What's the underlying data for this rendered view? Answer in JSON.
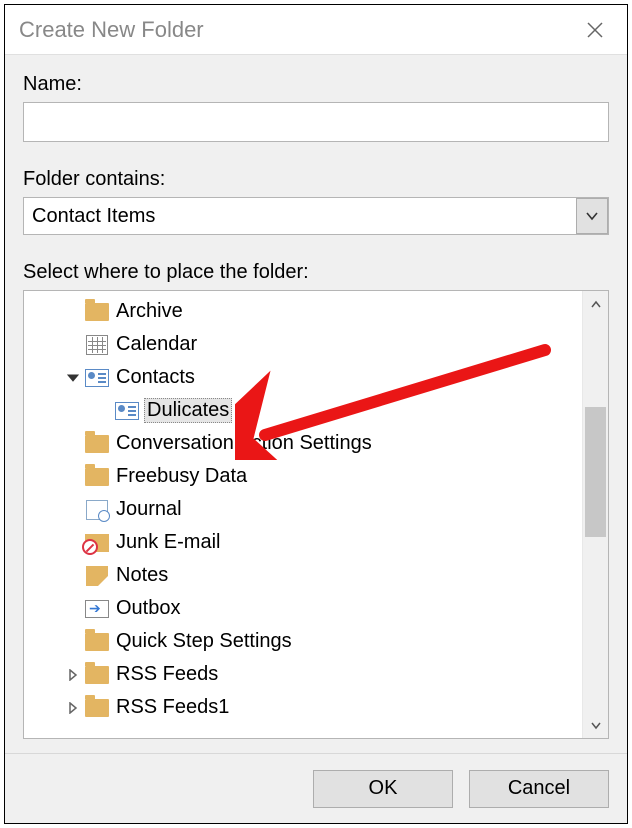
{
  "title": "Create New Folder",
  "labels": {
    "name": "Name:",
    "folder_contains": "Folder contains:",
    "select_where": "Select where to place the folder:"
  },
  "fields": {
    "name_value": "",
    "folder_contains_value": "Contact Items"
  },
  "tree": {
    "items": [
      {
        "label": "Archive",
        "icon": "folder",
        "indent": 2,
        "arrow": ""
      },
      {
        "label": "Calendar",
        "icon": "calendar",
        "indent": 2,
        "arrow": ""
      },
      {
        "label": "Contacts",
        "icon": "contacts",
        "indent": 2,
        "arrow": "down"
      },
      {
        "label": "Dulicates",
        "icon": "contacts",
        "indent": 3,
        "arrow": "",
        "selected": true
      },
      {
        "label": "Conversation Action Settings",
        "icon": "folder",
        "indent": 2,
        "arrow": ""
      },
      {
        "label": "Freebusy Data",
        "icon": "folder",
        "indent": 2,
        "arrow": ""
      },
      {
        "label": "Journal",
        "icon": "journal",
        "indent": 2,
        "arrow": ""
      },
      {
        "label": "Junk E-mail",
        "icon": "junk",
        "indent": 2,
        "arrow": ""
      },
      {
        "label": "Notes",
        "icon": "notes",
        "indent": 2,
        "arrow": ""
      },
      {
        "label": "Outbox",
        "icon": "outbox",
        "indent": 2,
        "arrow": ""
      },
      {
        "label": "Quick Step Settings",
        "icon": "folder",
        "indent": 2,
        "arrow": ""
      },
      {
        "label": "RSS Feeds",
        "icon": "folder",
        "indent": 2,
        "arrow": "right"
      },
      {
        "label": "RSS Feeds1",
        "icon": "folder",
        "indent": 2,
        "arrow": "right"
      }
    ]
  },
  "buttons": {
    "ok": "OK",
    "cancel": "Cancel"
  },
  "annotation": {
    "arrow_color": "#ea1616"
  }
}
